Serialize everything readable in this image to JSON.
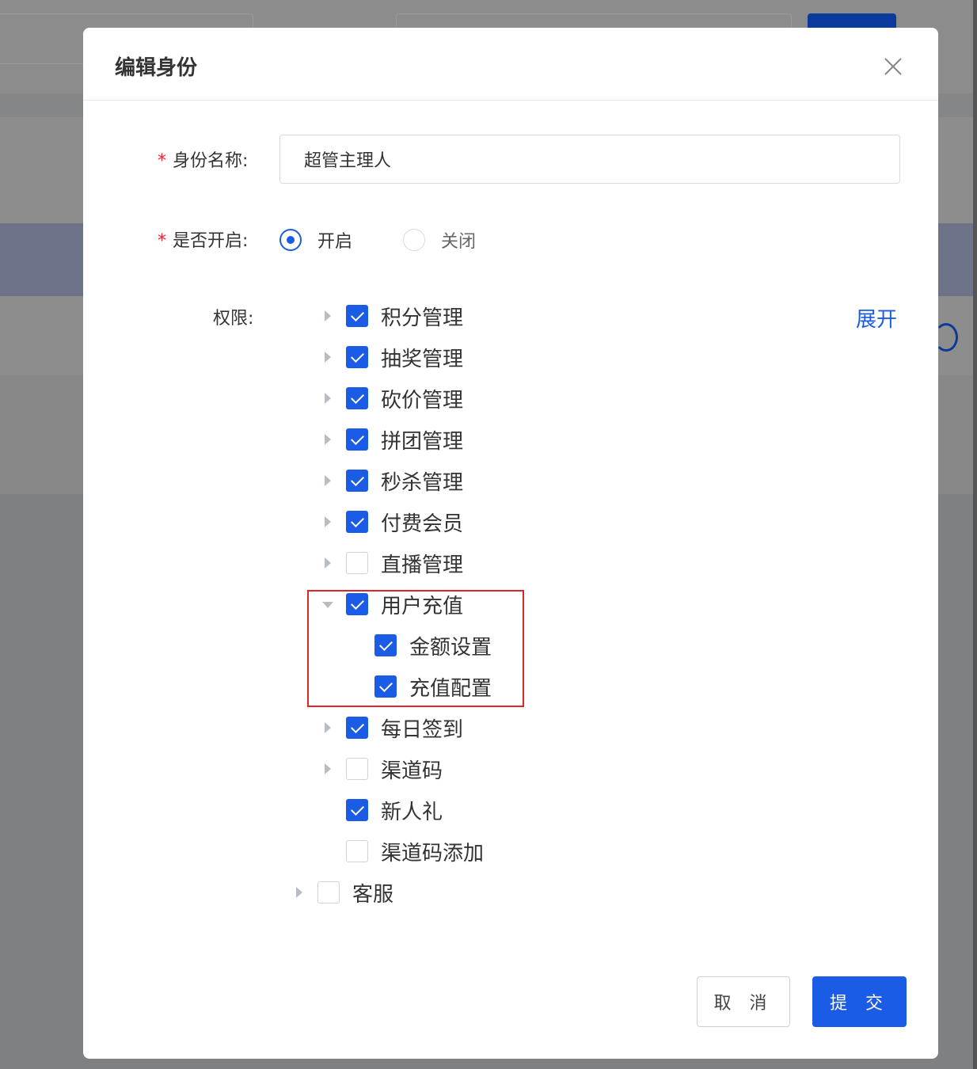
{
  "modal": {
    "title": "编辑身份",
    "cancel_label": "取 消",
    "submit_label": "提 交"
  },
  "form": {
    "name_label": "身份名称:",
    "name_value": "超管主理人",
    "enabled_label": "是否开启:",
    "enabled_options": [
      {
        "label": "开启",
        "selected": true
      },
      {
        "label": "关闭",
        "selected": false
      }
    ],
    "permissions_label": "权限:",
    "expand_label": "展开",
    "required_mark": "*"
  },
  "tree": {
    "items": [
      {
        "label": "积分管理",
        "checked": true,
        "level": 1,
        "caret": "right"
      },
      {
        "label": "抽奖管理",
        "checked": true,
        "level": 1,
        "caret": "right"
      },
      {
        "label": "砍价管理",
        "checked": true,
        "level": 1,
        "caret": "right"
      },
      {
        "label": "拼团管理",
        "checked": true,
        "level": 1,
        "caret": "right"
      },
      {
        "label": "秒杀管理",
        "checked": true,
        "level": 1,
        "caret": "right"
      },
      {
        "label": "付费会员",
        "checked": true,
        "level": 1,
        "caret": "right"
      },
      {
        "label": "直播管理",
        "checked": false,
        "level": 1,
        "caret": "right"
      },
      {
        "label": "用户充值",
        "checked": true,
        "level": 1,
        "caret": "down"
      },
      {
        "label": "金额设置",
        "checked": true,
        "level": 2,
        "caret": "none"
      },
      {
        "label": "充值配置",
        "checked": true,
        "level": 2,
        "caret": "none"
      },
      {
        "label": "每日签到",
        "checked": true,
        "level": 1,
        "caret": "right"
      },
      {
        "label": "渠道码",
        "checked": false,
        "level": 1,
        "caret": "right"
      },
      {
        "label": "新人礼",
        "checked": true,
        "level": 1,
        "caret": "none"
      },
      {
        "label": "渠道码添加",
        "checked": false,
        "level": 1,
        "caret": "none"
      },
      {
        "label": "客服",
        "checked": false,
        "level": 0,
        "caret": "right"
      }
    ]
  }
}
